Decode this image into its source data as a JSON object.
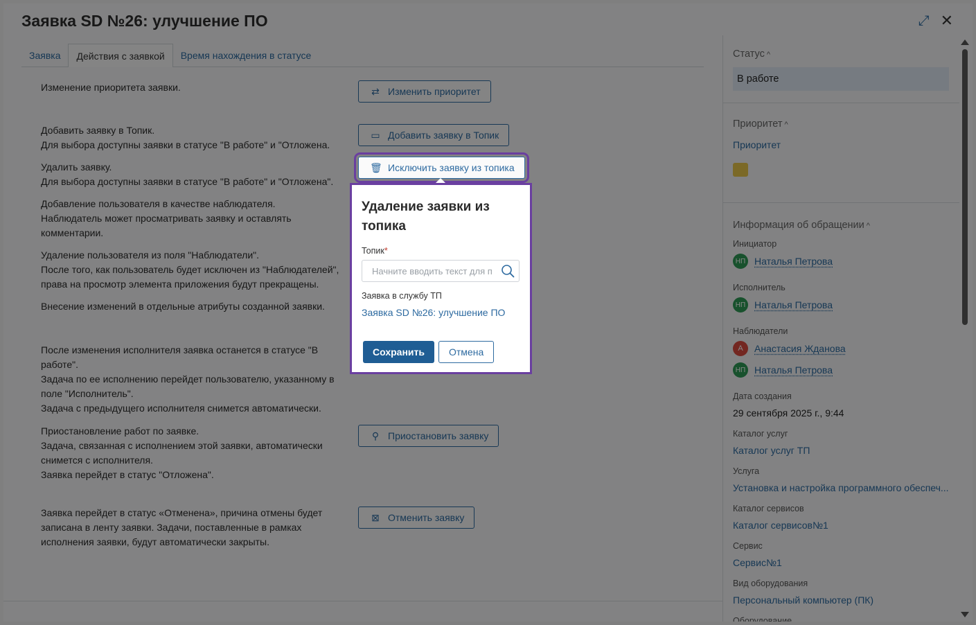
{
  "window": {
    "title": "Заявка SD №26: улучшение ПО",
    "expand_glyph": "⤢",
    "close_glyph": "✕"
  },
  "tabs": [
    {
      "label": "Заявка"
    },
    {
      "label": "Действия с заявкой"
    },
    {
      "label": "Время нахождения в статусе"
    }
  ],
  "actions": [
    {
      "text": "Изменение приоритета заявки.",
      "button": "Изменить приоритет",
      "icon": "⇄"
    },
    {
      "text": "Добавить заявку в Топик.\nДля выбора доступны заявки в статусе \"В работе\" и \"Отложена.",
      "button": "Добавить заявку в Топик",
      "icon": "▭"
    },
    {
      "text": "Удалить заявку.\nДля выбора доступны заявки в статусе \"В работе\" и \"Отложена\".",
      "button": "Исключить заявку из топика",
      "icon": "🗑"
    },
    {
      "text": "Добавление пользователя в качестве наблюдателя.\nНаблюдатель может просматривать заявку и оставлять комментарии."
    },
    {
      "text": "Удаление пользователя из поля \"Наблюдатели\".\nПосле того, как пользователь будет исключен из \"Наблюдателей\", права на просмотр элемента приложения будут прекращены."
    },
    {
      "text": "Внесение изменений в отдельные атрибуты созданной заявки."
    },
    {
      "text": "После изменения исполнителя заявка останется в статусе \"В работе\".\nЗадача по ее исполнению перейдет пользователю, указанному в поле \"Исполнитель\".\nЗадача с предыдущего исполнителя снимется автоматически."
    },
    {
      "text": "Приостановление работ по заявке.\nЗадача, связанная с исполнением этой заявки, автоматически снимется с исполнителя.\nЗаявка перейдет в статус \"Отложена\".",
      "button": "Приостановить заявку",
      "icon": "⚲"
    },
    {
      "text": "Заявка перейдет в статус «Отменена», причина отмены будет записана в ленту заявки. Задачи, поставленные в рамках исполнения заявки, будут автоматически закрыты.",
      "button": "Отменить заявку",
      "icon": "⊠"
    }
  ],
  "popover": {
    "title": "Удаление заявки из топика",
    "field_label": "Топик",
    "required_mark": "*",
    "placeholder": "Начните вводить текст для поиска",
    "sub_label": "Заявка в службу ТП",
    "sub_link": "Заявка SD №26: улучшение ПО",
    "save_label": "Сохранить",
    "cancel_label": "Отмена"
  },
  "sidebar": {
    "status_title": "Статус",
    "status_value": "В работе",
    "priority_title": "Приоритет",
    "priority_link": "Приоритет",
    "priority_color": "#e8c64a",
    "info_title": "Информация об обращении",
    "chevron": "^",
    "initiator_label": "Инициатор",
    "initiator": {
      "initials": "НП",
      "name": "Наталья Петрова"
    },
    "executor_label": "Исполнитель",
    "executor": {
      "initials": "НП",
      "name": "Наталья Петрова"
    },
    "observers_label": "Наблюдатели",
    "observers": [
      {
        "initials": "А",
        "name": "Анастасия Жданова"
      },
      {
        "initials": "НП",
        "name": "Наталья Петрова"
      }
    ],
    "created_label": "Дата создания",
    "created_value": "29 сентября 2025 г., 9:44",
    "catalog_label": "Каталог услуг",
    "catalog_value": "Каталог услуг ТП",
    "service_label": "Услуга",
    "service_value": "Установка и настройка программного обеспеч...",
    "svc_catalog_label": "Каталог сервисов",
    "svc_catalog_value": "Каталог сервисов№1",
    "svc_label": "Сервис",
    "svc_value": "Сервис№1",
    "equip_type_label": "Вид оборудования",
    "equip_type_value": "Персональный компьютер (ПК)",
    "equip_label": "Оборудование"
  },
  "colors": {
    "accent": "#2d6aa0",
    "primary_button": "#1f5d94",
    "highlight": "#6a3fa0",
    "avatar_green": "#2e9a55",
    "avatar_red": "#d94b3f"
  }
}
